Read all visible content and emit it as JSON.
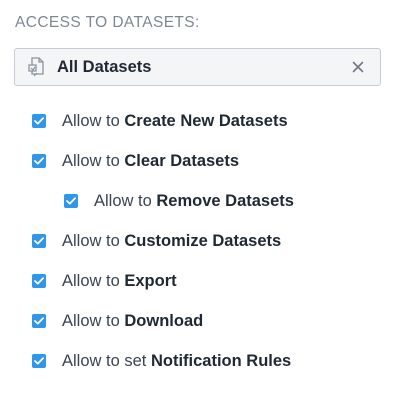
{
  "section": {
    "label": "ACCESS TO DATASETS:"
  },
  "selector": {
    "value": "All Datasets",
    "icon": "dataset-file-icon",
    "clear_icon": "close-icon"
  },
  "colors": {
    "checkbox": "#2f96e8",
    "selector_bg": "#f4f5f7",
    "label_gray": "#7d8794"
  },
  "permissions": [
    {
      "prefix": "Allow to",
      "name": "Create New Datasets",
      "checked": true,
      "indent": 0
    },
    {
      "prefix": "Allow to",
      "name": "Clear Datasets",
      "checked": true,
      "indent": 0
    },
    {
      "prefix": "Allow to",
      "name": "Remove Datasets",
      "checked": true,
      "indent": 1
    },
    {
      "prefix": "Allow to",
      "name": "Customize Datasets",
      "checked": true,
      "indent": 0
    },
    {
      "prefix": "Allow to",
      "name": "Export",
      "checked": true,
      "indent": 0
    },
    {
      "prefix": "Allow to",
      "name": "Download",
      "checked": true,
      "indent": 0
    },
    {
      "prefix": "Allow to set",
      "name": "Notification Rules",
      "checked": true,
      "indent": 0
    }
  ]
}
